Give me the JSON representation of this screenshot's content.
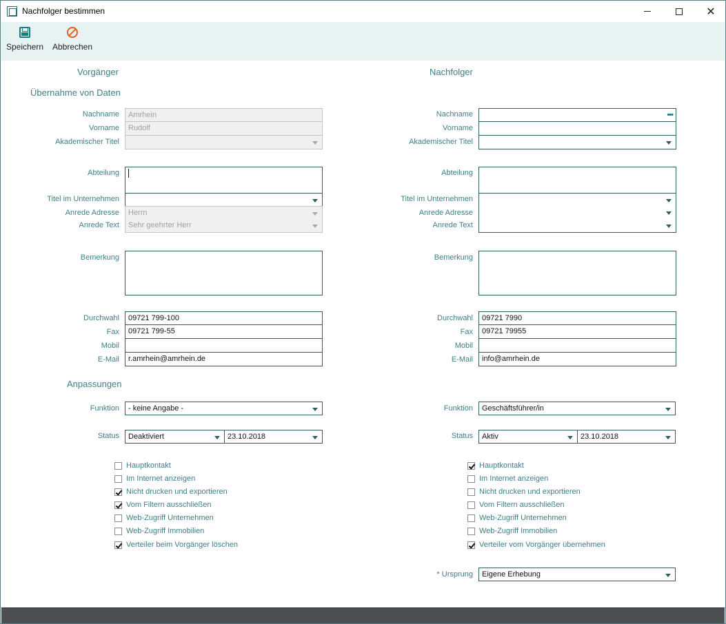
{
  "window": {
    "title": "Nachfolger bestimmen"
  },
  "toolbar": {
    "save_label": "Speichern",
    "cancel_label": "Abbrechen"
  },
  "headers": {
    "predecessor": "Vorgänger",
    "successor": "Nachfolger",
    "data_takeover": "Übernahme von Daten",
    "adjustments": "Anpassungen"
  },
  "labels": {
    "nachname": "Nachname",
    "vorname": "Vorname",
    "akad_titel": "Akademischer Titel",
    "abteilung": "Abteilung",
    "titel_unternehmen": "Titel im Unternehmen",
    "anrede_adresse": "Anrede Adresse",
    "anrede_text": "Anrede Text",
    "bemerkung": "Bemerkung",
    "durchwahl": "Durchwahl",
    "fax": "Fax",
    "mobil": "Mobil",
    "email": "E-Mail",
    "funktion": "Funktion",
    "status": "Status",
    "ursprung": "* Ursprung"
  },
  "left": {
    "nachname": "Amrhein",
    "vorname": "Rudolf",
    "akad_titel": "",
    "abteilung": "",
    "titel_unternehmen": "",
    "anrede_adresse": "Herrn",
    "anrede_text": "Sehr geehrter Herr",
    "bemerkung": "",
    "durchwahl": "09721 799-100",
    "fax": "09721 799-55",
    "mobil": "",
    "email": "r.amrhein@amrhein.de",
    "funktion": "- keine Angabe -",
    "status": "Deaktiviert",
    "status_date": "23.10.2018",
    "checkboxes": [
      {
        "label": "Hauptkontakt",
        "checked": false
      },
      {
        "label": "Im Internet anzeigen",
        "checked": false
      },
      {
        "label": "Nicht drucken und exportieren",
        "checked": true
      },
      {
        "label": "Vom Filtern ausschließen",
        "checked": true
      },
      {
        "label": "Web-Zugriff Unternehmen",
        "checked": false
      },
      {
        "label": "Web-Zugriff Immobilien",
        "checked": false
      },
      {
        "label": "Verteiler beim Vorgänger löschen",
        "checked": true
      }
    ]
  },
  "right": {
    "nachname": "",
    "vorname": "",
    "akad_titel": "",
    "abteilung": "",
    "titel_unternehmen": "",
    "anrede_adresse": "",
    "anrede_text": "",
    "bemerkung": "",
    "durchwahl": "09721 7990",
    "fax": "09721 79955",
    "mobil": "",
    "email": "info@amrhein.de",
    "funktion": "Geschäftsführer/in",
    "status": "Aktiv",
    "status_date": "23.10.2018",
    "ursprung": "Eigene Erhebung",
    "checkboxes": [
      {
        "label": "Hauptkontakt",
        "checked": true
      },
      {
        "label": "Im Internet anzeigen",
        "checked": false
      },
      {
        "label": "Nicht drucken und exportieren",
        "checked": false
      },
      {
        "label": "Vom Filtern ausschließen",
        "checked": false
      },
      {
        "label": "Web-Zugriff Unternehmen",
        "checked": false
      },
      {
        "label": "Web-Zugriff Immobilien",
        "checked": false
      },
      {
        "label": "Verteiler vom Vorgänger übernehmen",
        "checked": true
      }
    ]
  },
  "colors": {
    "accent": "#137e86",
    "label": "#3f7f86",
    "toolbar_bg": "#e7f3f3",
    "cancel_icon": "#e0621a",
    "statusbar": "#4b4f52"
  },
  "icons": {
    "save": "floppy-disk-icon",
    "cancel": "no-entry-icon",
    "lookup": "ellipsis-icon",
    "dropdown": "chevron-down-icon"
  }
}
